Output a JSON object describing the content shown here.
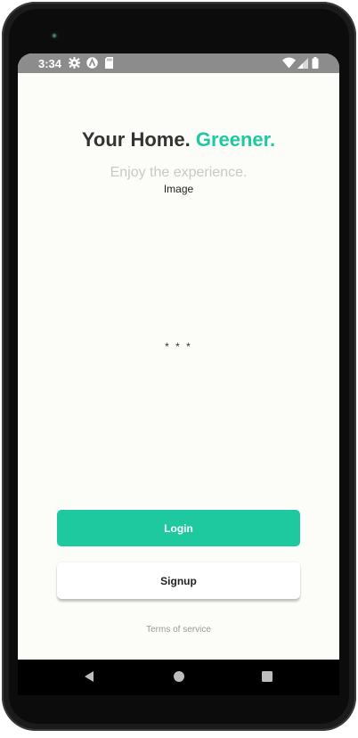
{
  "status_bar": {
    "time": "3:34",
    "icons": [
      "gear-icon",
      "app-logo-icon",
      "sd-card-icon",
      "wifi-icon",
      "signal-icon",
      "battery-icon"
    ],
    "background": "#8c8c8c"
  },
  "header": {
    "title_main": "Your Home.",
    "title_accent": "Greener.",
    "subtitle": "Enjoy the experience."
  },
  "hero": {
    "image_label": "Image",
    "dots": "* * *"
  },
  "actions": {
    "login_label": "Login",
    "signup_label": "Signup"
  },
  "footer": {
    "terms_label": "Terms of service"
  },
  "navigation": {
    "buttons": [
      "back-icon",
      "home-icon",
      "recents-icon"
    ]
  },
  "colors": {
    "accent": "#1ec9a0",
    "screen_background": "#fcfcf9",
    "title_text": "#333333",
    "subtitle_text": "#c8c8c8"
  }
}
